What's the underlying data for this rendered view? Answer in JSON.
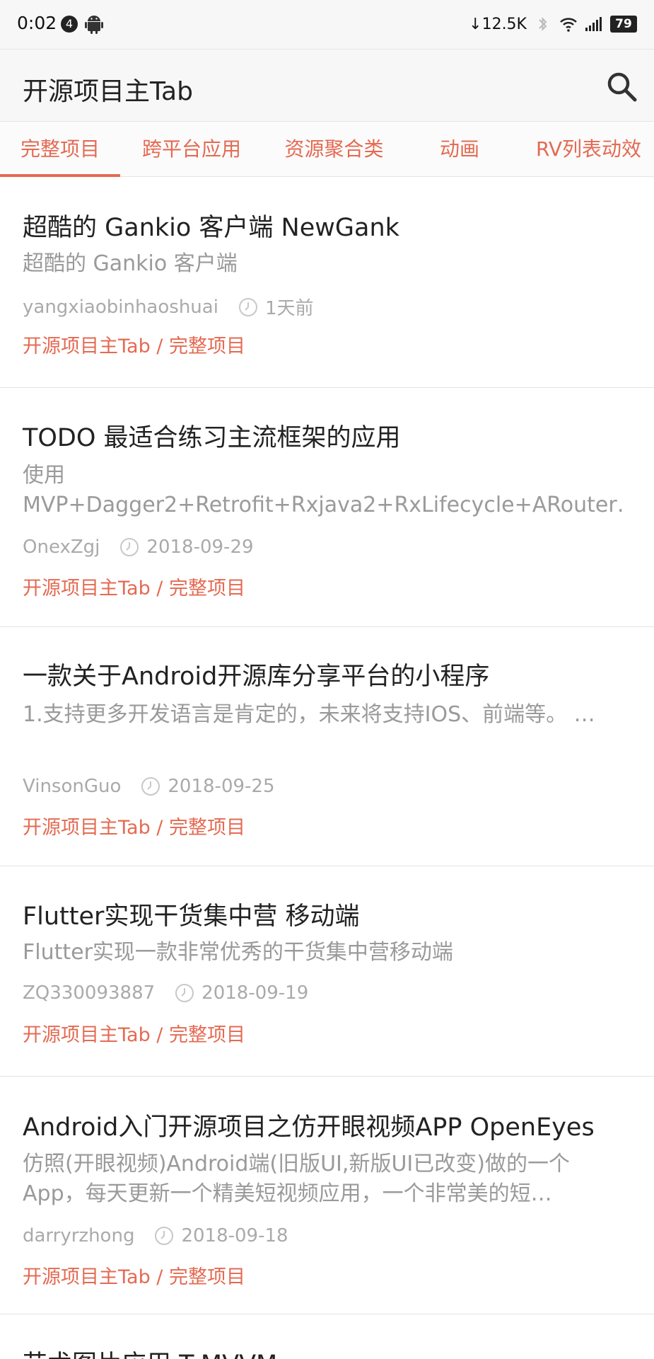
{
  "status_bar": {
    "time": "0:02",
    "notif_count": "4",
    "net_speed": "↓12.5K",
    "battery": "79"
  },
  "app_bar": {
    "title": "开源项目主Tab"
  },
  "tabs": [
    {
      "label": "完整项目",
      "selected": true
    },
    {
      "label": "跨平台应用",
      "selected": false
    },
    {
      "label": "资源聚合类",
      "selected": false
    },
    {
      "label": "动画",
      "selected": false
    },
    {
      "label": "RV列表动效",
      "selected": false
    }
  ],
  "articles": [
    {
      "title": "超酷的 Gankio 客户端 NewGank",
      "desc": "超酷的 Gankio 客户端",
      "author": "yangxiaobinhaoshuai",
      "time": "1天前",
      "chapter": "开源项目主Tab / 完整项目"
    },
    {
      "title": " TODO 最适合练习主流框架的应用",
      "desc": "使用 MVP+Dagger2+Retrofit+Rxjava2+RxLifecycle+ARouter…",
      "author": "OnexZgj",
      "time": "2018-09-29",
      "chapter": "开源项目主Tab / 完整项目"
    },
    {
      "title": "一款关于Android开源库分享平台的小程序",
      "desc": "1.支持更多开发语言是肯定的，未来将支持IOS、前端等。 …",
      "author": "VinsonGuo",
      "time": "2018-09-25",
      "chapter": "开源项目主Tab / 完整项目"
    },
    {
      "title": "Flutter实现干货集中营 移动端",
      "desc": "Flutter实现一款非常优秀的干货集中营移动端",
      "author": "ZQ330093887",
      "time": "2018-09-19",
      "chapter": "开源项目主Tab / 完整项目"
    },
    {
      "title": "Android入门开源项目之仿开眼视频APP OpenEyes",
      "desc": "仿照(开眼视频)Android端(旧版UI,新版UI已改变)做的一个App，每天更新一个精美短视频应用，一个非常美的短…",
      "author": "darryrzhong",
      "time": "2018-09-18",
      "chapter": "开源项目主Tab / 完整项目"
    },
    {
      "title": "艺术图片应用 T-MVVM"
    }
  ],
  "colors": {
    "accent": "#e46a52",
    "secondary_text": "#9a9a9a",
    "divider": "#e3e3e3"
  }
}
